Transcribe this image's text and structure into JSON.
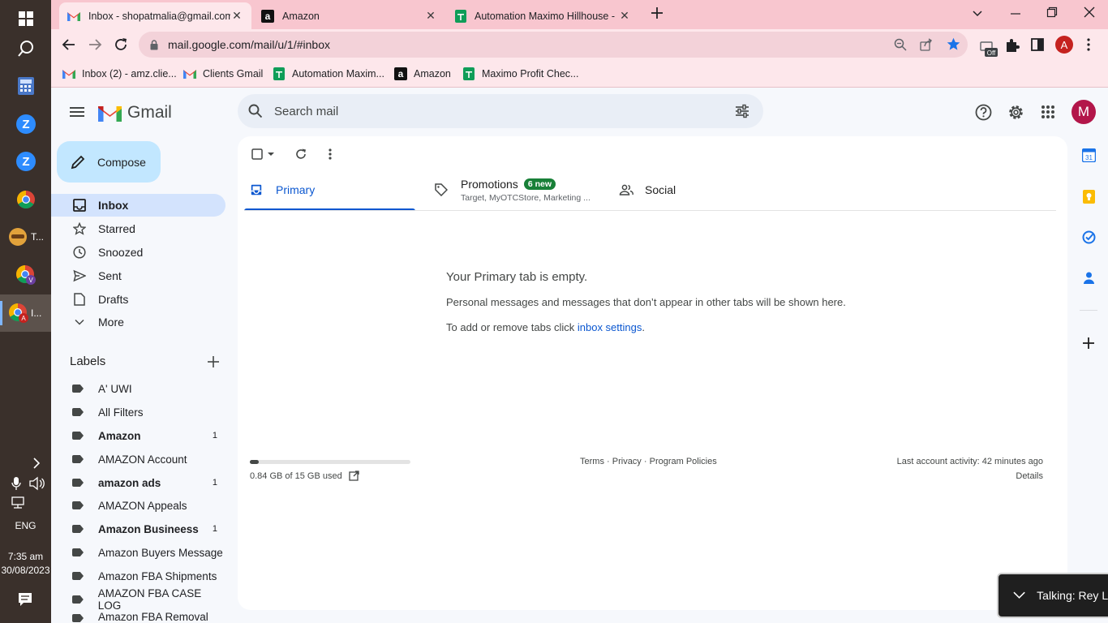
{
  "taskbar": {
    "time": "7:35 am",
    "date": "30/08/2023",
    "lang": "ENG",
    "app_t_label": "T...",
    "app_chrome_label": "I..."
  },
  "chrome": {
    "tabs": [
      {
        "title": "Inbox - shopatmalia@gmail.com",
        "active": true
      },
      {
        "title": "Amazon",
        "active": false
      },
      {
        "title": "Automation Maximo Hillhouse - ...",
        "active": false
      }
    ],
    "url": "mail.google.com/mail/u/1/#inbox",
    "profile_initial": "A",
    "extension_badge": "Off",
    "bookmarks": [
      {
        "label": "Inbox (2) - amz.clie...",
        "icon": "gmail-icon"
      },
      {
        "label": "Clients Gmail",
        "icon": "gmail-icon"
      },
      {
        "label": "Automation Maxim...",
        "icon": "sheets-icon"
      },
      {
        "label": "Amazon",
        "icon": "amazon-icon"
      },
      {
        "label": "Maximo Profit Chec...",
        "icon": "sheets-icon"
      }
    ]
  },
  "gmail": {
    "logo_text": "Gmail",
    "search_placeholder": "Search mail",
    "avatar_initial": "M",
    "compose_label": "Compose",
    "nav": [
      {
        "label": "Inbox",
        "icon": "inbox-icon",
        "selected": true
      },
      {
        "label": "Starred",
        "icon": "star-icon"
      },
      {
        "label": "Snoozed",
        "icon": "clock-icon"
      },
      {
        "label": "Sent",
        "icon": "send-icon"
      },
      {
        "label": "Drafts",
        "icon": "draft-icon"
      },
      {
        "label": "More",
        "icon": "chevron-down-icon"
      }
    ],
    "labels_heading": "Labels",
    "labels": [
      {
        "name": "A' UWI",
        "count": "",
        "bold": false
      },
      {
        "name": "All Filters",
        "count": "",
        "bold": false
      },
      {
        "name": "Amazon",
        "count": "1",
        "bold": true
      },
      {
        "name": "AMAZON Account",
        "count": "",
        "bold": false
      },
      {
        "name": "amazon ads",
        "count": "1",
        "bold": true
      },
      {
        "name": "AMAZON Appeals",
        "count": "",
        "bold": false
      },
      {
        "name": "Amazon Busineess",
        "count": "1",
        "bold": true
      },
      {
        "name": "Amazon Buyers Message",
        "count": "",
        "bold": false
      },
      {
        "name": "Amazon FBA Shipments",
        "count": "",
        "bold": false
      },
      {
        "name": "AMAZON FBA CASE LOG",
        "count": "",
        "bold": false
      },
      {
        "name": "Amazon FBA Removal",
        "count": "",
        "bold": false
      }
    ],
    "tabs": {
      "primary": "Primary",
      "promotions": "Promotions",
      "promotions_badge": "6 new",
      "promotions_sub": "Target, MyOTCStore, Marketing ...",
      "social": "Social"
    },
    "empty": {
      "title": "Your Primary tab is empty.",
      "message": "Personal messages and messages that don’t appear in other tabs will be shown here.",
      "settings_prefix": "To add or remove tabs click ",
      "settings_link": "inbox settings",
      "settings_suffix": "."
    },
    "footer": {
      "storage": "0.84 GB of 15 GB used",
      "storage_fraction": 0.056,
      "terms": "Terms",
      "privacy": "Privacy",
      "policies": "Program Policies",
      "sep": "·",
      "activity": "Last account activity: 42 minutes ago",
      "details": "Details"
    }
  },
  "toast": {
    "text": "Talking: Rey Lla"
  },
  "colors": {
    "accent": "#0b57d0",
    "selected_nav": "#d3e3fd",
    "compose_bg": "#c2e7ff",
    "chrome_frame": "#f8c6cf",
    "badge_green": "#188038",
    "avatar": "#b3164a"
  }
}
